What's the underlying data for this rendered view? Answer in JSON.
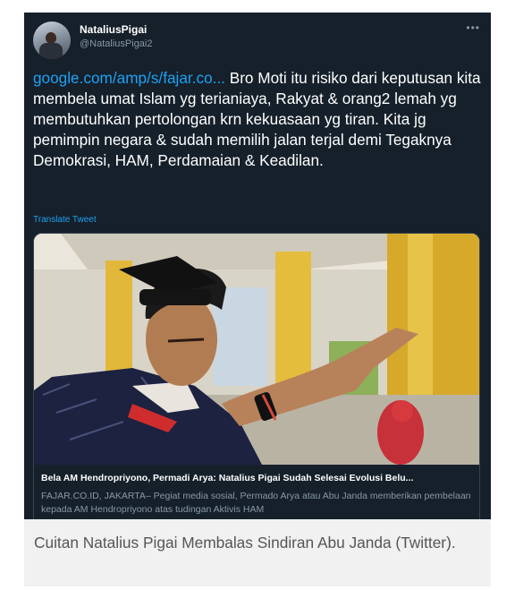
{
  "tweet": {
    "display_name": "NataliusPigai",
    "handle": "@NataliusPigai2",
    "more_icon": "ellipsis-icon",
    "link_text": "google.com/amp/s/fajar.co...",
    "body_text": " Bro Moti itu risiko dari keputusan kita membela umat Islam yg terianiaya, Rakyat & orang2 lemah yg membutuhkan pertolongan krn kekuasaan yg tiran. Kita jg pemimpin negara  & sudah memilih jalan terjal demi Tegaknya Demokrasi, HAM, Perdamaian & Keadilan.",
    "translate_label": "Translate Tweet",
    "card": {
      "title": "Bela AM Hendropriyono, Permadi Arya: Natalius Pigai Sudah Selesai Evolusi Belu...",
      "description": "FAJAR.CO.ID, JAKARTA– Pegiat media sosial, Permado Arya atau Abu Janda memberikan pembelaan kepada AM Hendropriyono atas tudingan Aktivis HAM"
    }
  },
  "caption": "Cuitan Natalius Pigai Membalas Sindiran Abu Janda (Twitter).",
  "colors": {
    "background": "#15202b",
    "link": "#1da1f2",
    "muted": "#8899a6",
    "caption_bg": "#f1f1f1"
  }
}
